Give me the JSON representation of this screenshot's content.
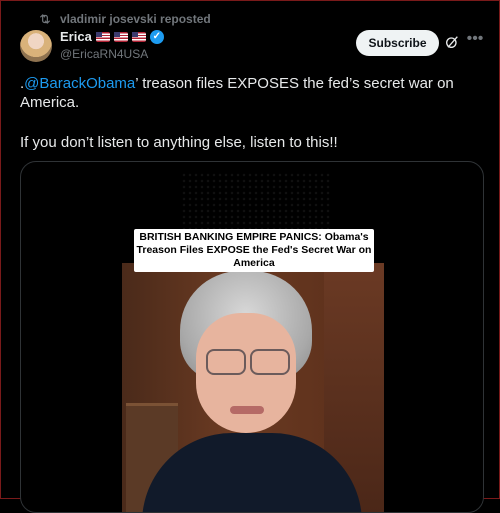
{
  "repost": {
    "label": "vladimir josevski reposted"
  },
  "author": {
    "name": "Erica",
    "handle": "@EricaRN4USA"
  },
  "actions": {
    "subscribe_label": "Subscribe"
  },
  "tweet": {
    "mention": "@BarackObama",
    "prefix": ".",
    "text_after_mention": "’ treason files EXPOSES the fed’s secret war on America.",
    "line2": "If you don’t listen to anything else, listen to this!!"
  },
  "media": {
    "caption": "BRITISH BANKING EMPIRE PANICS: Obama's Treason Files EXPOSE the Fed's Secret War on America"
  },
  "colors": {
    "accent": "#1d9bf0",
    "background": "#000000",
    "muted": "#71767b"
  },
  "icons": [
    "repost-icon",
    "verified-badge-icon",
    "grok-icon",
    "more-options-icon",
    "us-flag-icon"
  ]
}
